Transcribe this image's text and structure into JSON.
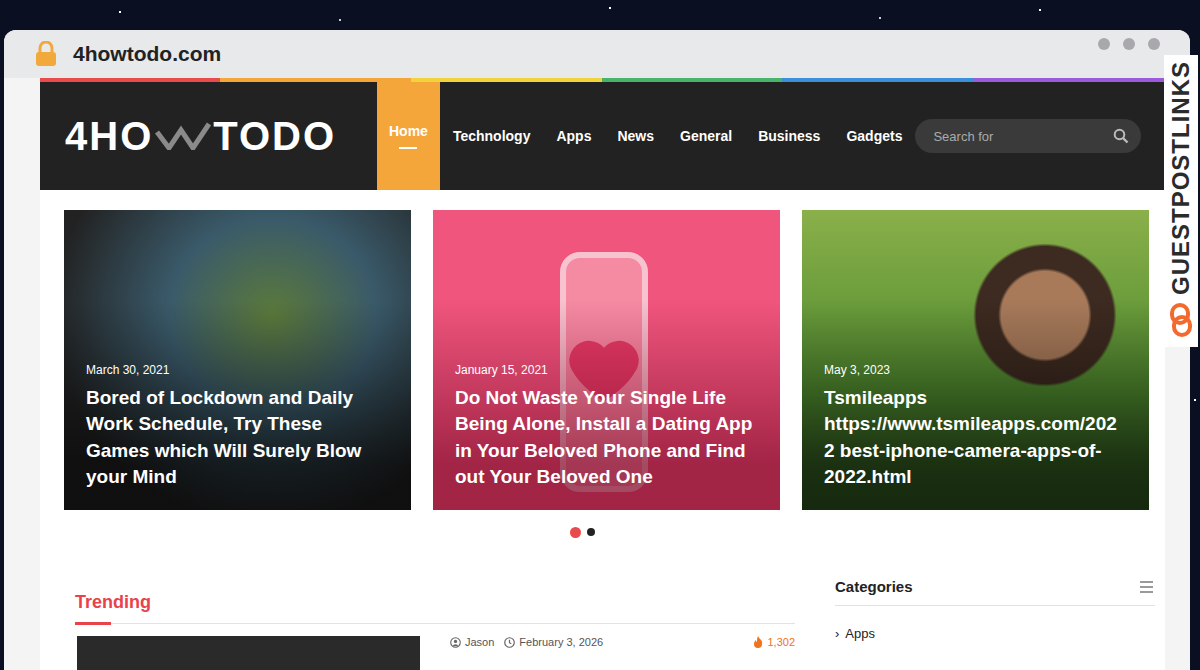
{
  "browser": {
    "address": "4howtodo.com"
  },
  "watermark": "GUESTPOSTLINKS",
  "site": {
    "logo": {
      "before": "4HO",
      "after": "TODO"
    },
    "nav": [
      {
        "label": "Home",
        "selected": true
      },
      {
        "label": "Technology",
        "selected": false
      },
      {
        "label": "Apps",
        "selected": false
      },
      {
        "label": "News",
        "selected": false
      },
      {
        "label": "General",
        "selected": false
      },
      {
        "label": "Business",
        "selected": false
      },
      {
        "label": "Gadgets",
        "selected": false
      }
    ],
    "search": {
      "placeholder": "Search for"
    }
  },
  "slider": {
    "cards": [
      {
        "kind": "photo",
        "date": "March 30, 2021",
        "title": "Bored of Lockdown and Daily Work Schedule, Try These Games which Will Surely Blow your Mind"
      },
      {
        "kind": "illustration",
        "date": "January 15, 2021",
        "title": "Do Not Waste Your Single Life Being Alone, Install a Dating App in Your Beloved Phone and Find out Your Beloved One"
      },
      {
        "kind": "photo",
        "date": "May 3, 2023",
        "title": "Tsmileapps https://www.tsmileapps.com/2022 best-iphone-camera-apps-of-2022.html"
      }
    ],
    "dots": [
      {
        "selected": true
      },
      {
        "selected": false
      }
    ]
  },
  "trending": {
    "title": "Trending",
    "posts": [
      {
        "author": "Jason",
        "date": "February 3, 2026",
        "views": "1,302"
      }
    ]
  },
  "sidebar": {
    "title": "Categories",
    "items": [
      {
        "icon": "›",
        "label": "Apps"
      }
    ]
  }
}
